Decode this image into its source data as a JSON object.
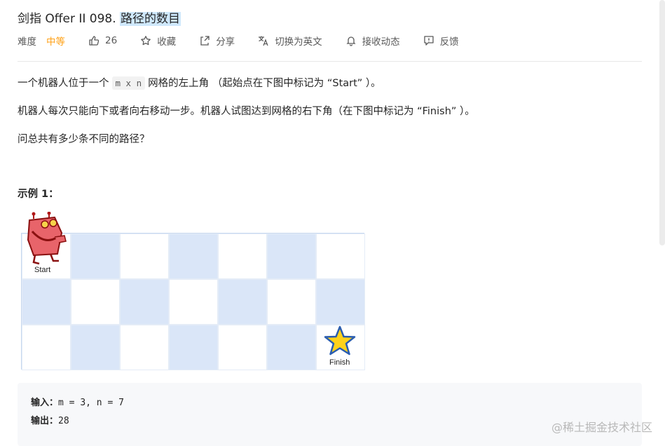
{
  "problem": {
    "title_prefix": "剑指 Offer II 098. ",
    "title_highlight": "路径的数目"
  },
  "meta": {
    "difficulty_label": "难度",
    "difficulty_value": "中等",
    "likes": "26",
    "favorite_label": "收藏",
    "share_label": "分享",
    "switch_lang_label": "切换为英文",
    "subscribe_label": "接收动态",
    "feedback_label": "反馈"
  },
  "description": {
    "p1_before": "一个机器人位于一个",
    "p1_code": "m x n",
    "p1_after": "网格的左上角 （起始点在下图中标记为 “Start” ）。",
    "p2": "机器人每次只能向下或者向右移动一步。机器人试图达到网格的右下角（在下图中标记为 “Finish” ）。",
    "p3": "问总共有多少条不同的路径？"
  },
  "example": {
    "title": "示例 1：",
    "start_label": "Start",
    "finish_label": "Finish",
    "input_label": "输入：",
    "input_value": "m = 3, n = 7",
    "output_label": "输出：",
    "output_value": "28"
  },
  "colors": {
    "difficulty": "#ffa116",
    "grid_blue": "#dae6f8"
  },
  "watermark": "@稀土掘金技术社区"
}
